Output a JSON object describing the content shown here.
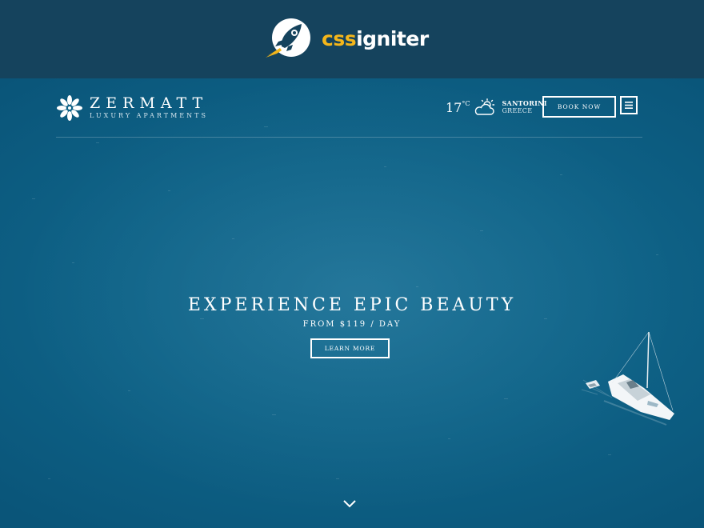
{
  "promo": {
    "brand_prefix": "css",
    "brand_suffix": "igniter",
    "background": "#15435d",
    "accent": "#f4b61a",
    "icon": "rocket-icon"
  },
  "header": {
    "logo_icon": "flower-icon",
    "site_title": "ZERMATT",
    "site_tagline": "LUXURY APARTMENTS",
    "weather": {
      "temperature": "17",
      "unit": "°C",
      "icon": "partly-cloudy-icon",
      "city": "SANTORINI",
      "country": "GREECE"
    },
    "book_now_label": "BOOK NOW",
    "menu_icon": "hamburger-icon"
  },
  "hero": {
    "headline": "EXPERIENCE EPIC BEAUTY",
    "price_line": "FROM $119 / DAY",
    "cta_label": "LEARN MORE",
    "scroll_icon": "chevron-down-icon",
    "background_color": "#0f6489"
  }
}
